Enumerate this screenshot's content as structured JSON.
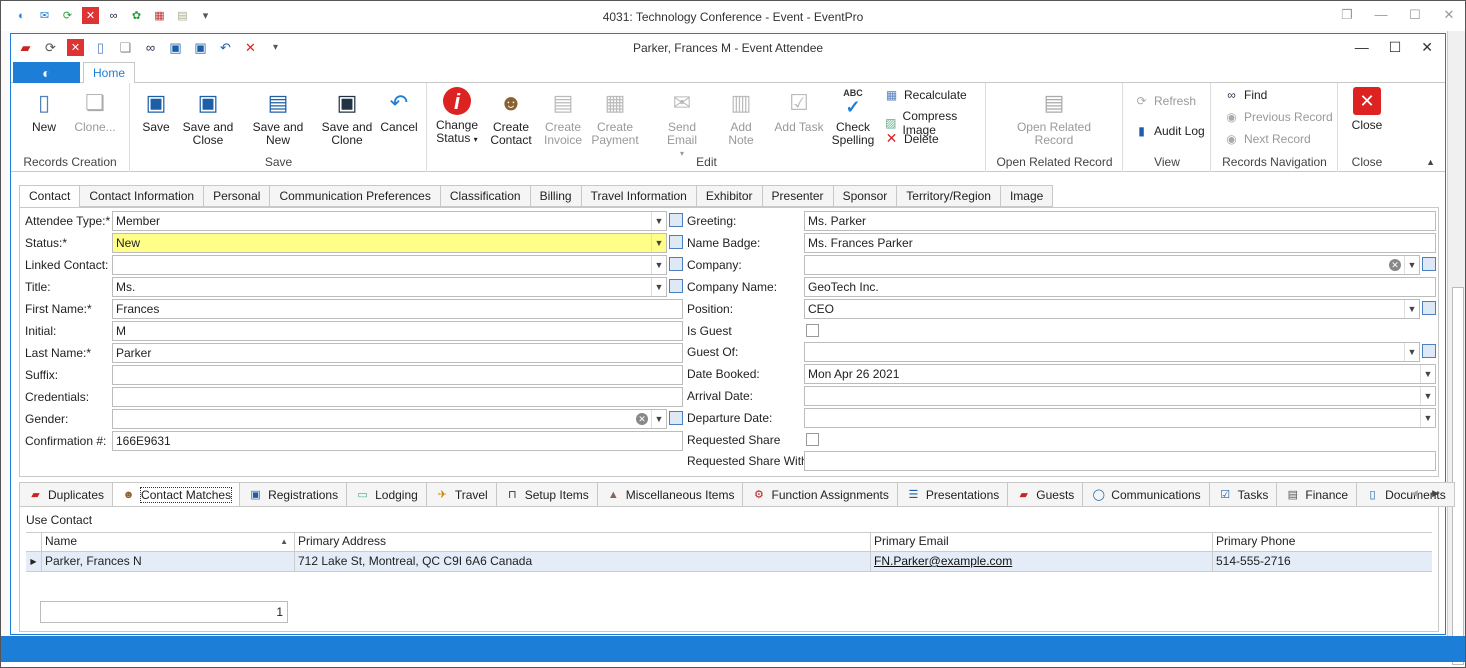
{
  "outer_window": {
    "title": "4031: Technology Conference - Event - EventPro"
  },
  "window": {
    "title": "Parker, Frances M - Event Attendee"
  },
  "ribbon": {
    "home_tab": "Home",
    "groups": {
      "records_creation": {
        "label": "Records Creation",
        "new": "New",
        "clone": "Clone..."
      },
      "save": {
        "label": "Save",
        "save": "Save",
        "save_close": [
          "Save and",
          "Close"
        ],
        "save_new": "Save and New",
        "save_clone": [
          "Save and",
          "Clone"
        ],
        "cancel": "Cancel"
      },
      "edit": {
        "label": "Edit",
        "change_status": [
          "Change",
          "Status"
        ],
        "create_contact": [
          "Create",
          "Contact"
        ],
        "create_invoice": [
          "Create",
          "Invoice"
        ],
        "create_payment": [
          "Create",
          "Payment"
        ],
        "send_email": "Send Email",
        "add_note": "Add Note",
        "add_task": "Add Task",
        "check_spelling": [
          "Check",
          "Spelling"
        ],
        "recalculate": "Recalculate",
        "compress_image": "Compress Image",
        "delete": "Delete",
        "abc": "ABC"
      },
      "open_related": {
        "label": "Open Related Record",
        "button": [
          "Open Related",
          "Record"
        ]
      },
      "view": {
        "label": "View",
        "refresh": "Refresh",
        "audit_log": "Audit Log"
      },
      "records_nav": {
        "label": "Records Navigation",
        "find": "Find",
        "previous": "Previous Record",
        "next": "Next Record"
      },
      "close": {
        "label": "Close",
        "button": "Close"
      }
    }
  },
  "form_tabs": [
    "Contact",
    "Contact Information",
    "Personal",
    "Communication Preferences",
    "Classification",
    "Billing",
    "Travel Information",
    "Exhibitor",
    "Presenter",
    "Sponsor",
    "Territory/Region",
    "Image"
  ],
  "left_fields": {
    "attendee_type": {
      "label": "Attendee Type:*",
      "value": "Member"
    },
    "status": {
      "label": "Status:*",
      "value": "New"
    },
    "linked_contact": {
      "label": "Linked Contact:",
      "value": ""
    },
    "title": {
      "label": "Title:",
      "value": "Ms."
    },
    "first_name": {
      "label": "First Name:*",
      "value": "Frances"
    },
    "initial": {
      "label": "Initial:",
      "value": "M"
    },
    "last_name": {
      "label": "Last Name:*",
      "value": "Parker"
    },
    "suffix": {
      "label": "Suffix:",
      "value": ""
    },
    "credentials": {
      "label": "Credentials:",
      "value": ""
    },
    "gender": {
      "label": "Gender:",
      "value": ""
    },
    "confirmation": {
      "label": "Confirmation #:",
      "value": "166E9631"
    }
  },
  "right_fields": {
    "greeting": {
      "label": "Greeting:",
      "value": "Ms. Parker"
    },
    "name_badge": {
      "label": "Name Badge:",
      "value": "Ms. Frances Parker"
    },
    "company": {
      "label": "Company:",
      "value": ""
    },
    "company_name": {
      "label": "Company Name:",
      "value": "GeoTech Inc."
    },
    "position": {
      "label": "Position:",
      "value": "CEO"
    },
    "is_guest": {
      "label": "Is Guest",
      "checked": false
    },
    "guest_of": {
      "label": "Guest Of:",
      "value": ""
    },
    "date_booked": {
      "label": "Date Booked:",
      "value": "Mon Apr 26 2021"
    },
    "arrival_date": {
      "label": "Arrival Date:",
      "value": ""
    },
    "departure_date": {
      "label": "Departure Date:",
      "value": ""
    },
    "requested_share": {
      "label": "Requested Share",
      "checked": false
    },
    "requested_share_with": {
      "label": "Requested Share With:",
      "value": ""
    }
  },
  "bottom_tabs": [
    "Duplicates",
    "Contact Matches",
    "Registrations",
    "Lodging",
    "Travel",
    "Setup Items",
    "Miscellaneous Items",
    "Function Assignments",
    "Presentations",
    "Guests",
    "Communications",
    "Tasks",
    "Finance",
    "Documents"
  ],
  "matches": {
    "use_contact": "Use Contact",
    "columns": [
      "Name",
      "Primary Address",
      "Primary Email",
      "Primary Phone"
    ],
    "rows": [
      {
        "name": "Parker, Frances N",
        "address": "712 Lake St, Montreal, QC C9I 6A6 Canada",
        "email": "FN.Parker@example.com",
        "phone": "514-555-2716"
      }
    ],
    "count": "1"
  }
}
